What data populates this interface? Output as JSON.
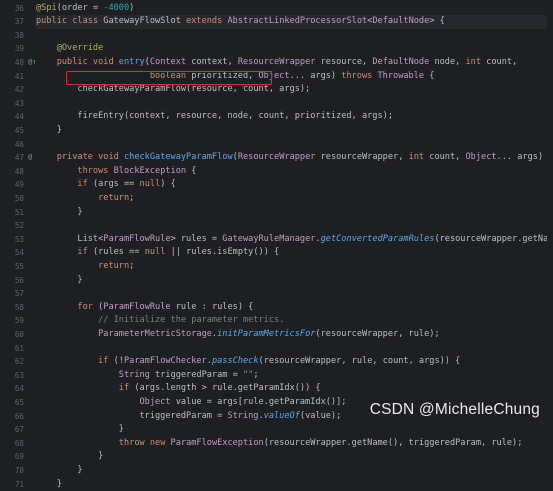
{
  "editor": {
    "first_line_number": 36,
    "lines": [
      {
        "n": "36",
        "tokens": [
          [
            "an",
            "@Spi"
          ],
          [
            "txt",
            "(order = "
          ],
          [
            "num",
            "-4000"
          ],
          [
            "txt",
            ")"
          ]
        ]
      },
      {
        "n": "37",
        "tokens": [
          [
            "kw",
            "public class "
          ],
          [
            "txt",
            "GatewayFlowSlot "
          ],
          [
            "kw",
            "extends "
          ],
          [
            "typ",
            "AbstractLinkedProcessorSlot"
          ],
          [
            "txt",
            "<"
          ],
          [
            "typ",
            "DefaultNode"
          ],
          [
            "txt",
            "> {"
          ]
        ],
        "current": true
      },
      {
        "n": "38",
        "tokens": []
      },
      {
        "n": "39",
        "tokens": [
          [
            "txt",
            "    "
          ],
          [
            "an",
            "@Override"
          ]
        ]
      },
      {
        "n": "40",
        "mark": "@↑",
        "tokens": [
          [
            "txt",
            "    "
          ],
          [
            "kw",
            "public void "
          ],
          [
            "fn",
            "entry"
          ],
          [
            "txt",
            "("
          ],
          [
            "typ",
            "Context"
          ],
          [
            "txt",
            " context, "
          ],
          [
            "typ",
            "ResourceWrapper"
          ],
          [
            "txt",
            " resource, "
          ],
          [
            "typ",
            "DefaultNode"
          ],
          [
            "txt",
            " node, "
          ],
          [
            "kw",
            "int"
          ],
          [
            "txt",
            " count,"
          ]
        ]
      },
      {
        "n": "41",
        "tokens": [
          [
            "txt",
            "                      "
          ],
          [
            "kw",
            "boolean"
          ],
          [
            "txt",
            " prioritized, "
          ],
          [
            "typ",
            "Object"
          ],
          [
            "txt",
            "... args) "
          ],
          [
            "kw",
            "throws "
          ],
          [
            "typ",
            "Throwable"
          ],
          [
            "txt",
            " {"
          ]
        ]
      },
      {
        "n": "42",
        "tokens": [
          [
            "txt",
            "        "
          ],
          [
            "txt",
            "checkGatewayParamFlow(resource, count, args);"
          ]
        ]
      },
      {
        "n": "43",
        "tokens": []
      },
      {
        "n": "44",
        "tokens": [
          [
            "txt",
            "        fireEntry(context, resource, node, count, prioritized, args);"
          ]
        ]
      },
      {
        "n": "45",
        "tokens": [
          [
            "txt",
            "    }"
          ]
        ]
      },
      {
        "n": "46",
        "tokens": []
      },
      {
        "n": "47",
        "mark": "@",
        "tokens": [
          [
            "txt",
            "    "
          ],
          [
            "kw",
            "private void "
          ],
          [
            "fn",
            "checkGatewayParamFlow"
          ],
          [
            "txt",
            "("
          ],
          [
            "typ",
            "ResourceWrapper"
          ],
          [
            "txt",
            " resourceWrapper, "
          ],
          [
            "kw",
            "int"
          ],
          [
            "txt",
            " count, "
          ],
          [
            "typ",
            "Object"
          ],
          [
            "txt",
            "... args)"
          ]
        ]
      },
      {
        "n": "48",
        "tokens": [
          [
            "txt",
            "        "
          ],
          [
            "kw",
            "throws "
          ],
          [
            "typ",
            "BlockException"
          ],
          [
            "txt",
            " {"
          ]
        ]
      },
      {
        "n": "49",
        "tokens": [
          [
            "txt",
            "        "
          ],
          [
            "kw",
            "if"
          ],
          [
            "txt",
            " (args == "
          ],
          [
            "kw",
            "null"
          ],
          [
            "txt",
            ") {"
          ]
        ]
      },
      {
        "n": "50",
        "tokens": [
          [
            "txt",
            "            "
          ],
          [
            "kw",
            "return"
          ],
          [
            "txt",
            ";"
          ]
        ]
      },
      {
        "n": "51",
        "tokens": [
          [
            "txt",
            "        }"
          ]
        ]
      },
      {
        "n": "52",
        "tokens": []
      },
      {
        "n": "53",
        "tokens": [
          [
            "txt",
            "        List<"
          ],
          [
            "typ",
            "ParamFlowRule"
          ],
          [
            "txt",
            "> rules = "
          ],
          [
            "typ",
            "GatewayRuleManager"
          ],
          [
            "txt",
            "."
          ],
          [
            "sfn",
            "getConvertedParamRules"
          ],
          [
            "txt",
            "(resourceWrapper.getName());"
          ]
        ]
      },
      {
        "n": "54",
        "tokens": [
          [
            "txt",
            "        "
          ],
          [
            "kw",
            "if"
          ],
          [
            "txt",
            " (rules == "
          ],
          [
            "kw",
            "null"
          ],
          [
            "txt",
            " || rules.isEmpty()) {"
          ]
        ]
      },
      {
        "n": "55",
        "tokens": [
          [
            "txt",
            "            "
          ],
          [
            "kw",
            "return"
          ],
          [
            "txt",
            ";"
          ]
        ]
      },
      {
        "n": "56",
        "tokens": [
          [
            "txt",
            "        }"
          ]
        ]
      },
      {
        "n": "57",
        "tokens": []
      },
      {
        "n": "58",
        "tokens": [
          [
            "txt",
            "        "
          ],
          [
            "kw",
            "for"
          ],
          [
            "txt",
            " ("
          ],
          [
            "typ",
            "ParamFlowRule"
          ],
          [
            "txt",
            " rule : rules) {"
          ]
        ]
      },
      {
        "n": "59",
        "tokens": [
          [
            "txt",
            "            "
          ],
          [
            "cm",
            "// Initialize the parameter metrics."
          ]
        ]
      },
      {
        "n": "60",
        "tokens": [
          [
            "txt",
            "            "
          ],
          [
            "typ",
            "ParameterMetricStorage"
          ],
          [
            "txt",
            "."
          ],
          [
            "sfn",
            "initParamMetricsFor"
          ],
          [
            "txt",
            "(resourceWrapper, rule);"
          ]
        ]
      },
      {
        "n": "61",
        "tokens": []
      },
      {
        "n": "62",
        "tokens": [
          [
            "txt",
            "            "
          ],
          [
            "kw",
            "if"
          ],
          [
            "txt",
            " (!"
          ],
          [
            "typ",
            "ParamFlowChecker"
          ],
          [
            "txt",
            "."
          ],
          [
            "sfn",
            "passCheck"
          ],
          [
            "txt",
            "(resourceWrapper, rule, count, args)) {"
          ]
        ]
      },
      {
        "n": "63",
        "tokens": [
          [
            "txt",
            "                "
          ],
          [
            "typ",
            "String"
          ],
          [
            "txt",
            " triggeredParam = "
          ],
          [
            "str",
            "\"\""
          ],
          [
            "txt",
            ";"
          ]
        ]
      },
      {
        "n": "64",
        "tokens": [
          [
            "txt",
            "                "
          ],
          [
            "kw",
            "if"
          ],
          [
            "txt",
            " (args.length > rule.getParamIdx()) {"
          ]
        ]
      },
      {
        "n": "65",
        "tokens": [
          [
            "txt",
            "                    "
          ],
          [
            "typ",
            "Object"
          ],
          [
            "txt",
            " value = args[rule.getParamIdx()];"
          ]
        ]
      },
      {
        "n": "66",
        "tokens": [
          [
            "txt",
            "                    triggeredParam = "
          ],
          [
            "typ",
            "String"
          ],
          [
            "txt",
            "."
          ],
          [
            "sfn",
            "valueOf"
          ],
          [
            "txt",
            "(value);"
          ]
        ]
      },
      {
        "n": "67",
        "tokens": [
          [
            "txt",
            "                }"
          ]
        ]
      },
      {
        "n": "68",
        "tokens": [
          [
            "txt",
            "                "
          ],
          [
            "kw",
            "throw new "
          ],
          [
            "typ",
            "ParamFlowException"
          ],
          [
            "txt",
            "(resourceWrapper.getName(), triggeredParam, rule);"
          ]
        ]
      },
      {
        "n": "69",
        "tokens": [
          [
            "txt",
            "            }"
          ]
        ]
      },
      {
        "n": "70",
        "tokens": [
          [
            "txt",
            "        }"
          ]
        ]
      },
      {
        "n": "71",
        "tokens": [
          [
            "txt",
            "    }"
          ]
        ]
      }
    ]
  },
  "colors": {
    "background": "#1e1f22",
    "keyword": "#cf8e6d",
    "highlight_box": "#e8252c"
  },
  "watermark": {
    "text": "CSDN @MichelleChung"
  }
}
